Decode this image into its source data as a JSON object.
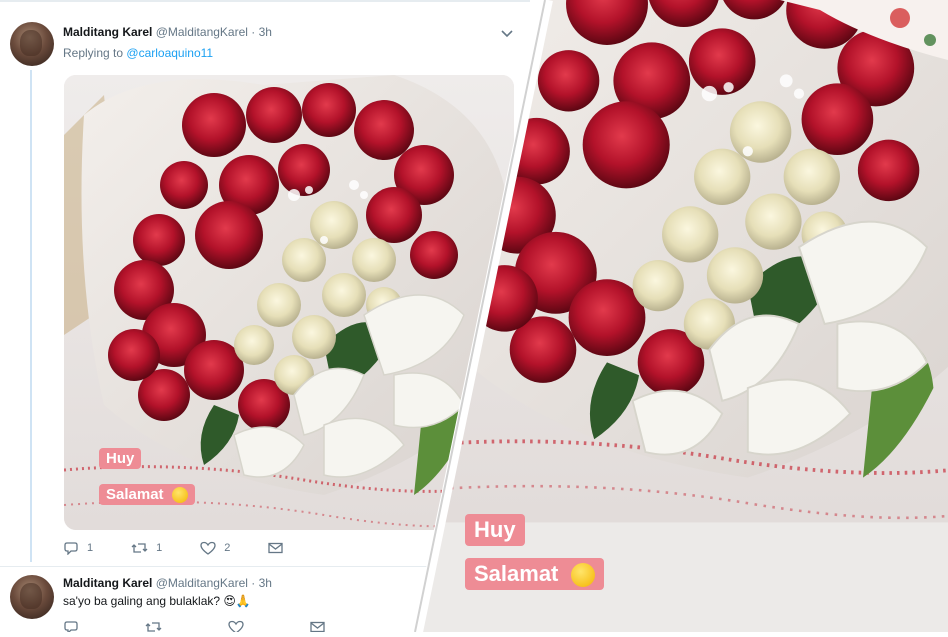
{
  "tweets": [
    {
      "author_name": "Malditang Karel",
      "author_handle": "@MalditangKarel",
      "time": "· 3h",
      "replying_prefix": "Replying to",
      "replying_handle": "@carloaquino11",
      "photo_stickers": [
        "Huy",
        "Salamat"
      ],
      "actions": {
        "replies": "1",
        "retweets": "1",
        "likes": "2"
      }
    },
    {
      "author_name": "Malditang Karel",
      "author_handle": "@MalditangKarel",
      "time": "· 3h",
      "text": "sa'yo ba galing ang bulaklak?",
      "emojis": "😍🙏"
    }
  ],
  "zoomed_photo": {
    "stickers": [
      "Huy",
      "Salamat"
    ]
  },
  "icons": {
    "reply": "reply-icon",
    "retweet": "retweet-icon",
    "like": "heart-icon",
    "message": "envelope-icon",
    "more": "chevron-down-icon"
  },
  "colors": {
    "link": "#1da1f2",
    "sticker": "#ee8c95",
    "thread_line": "#cfe3f4",
    "rose": "#b3122a",
    "lily": "#f4f3ee"
  }
}
